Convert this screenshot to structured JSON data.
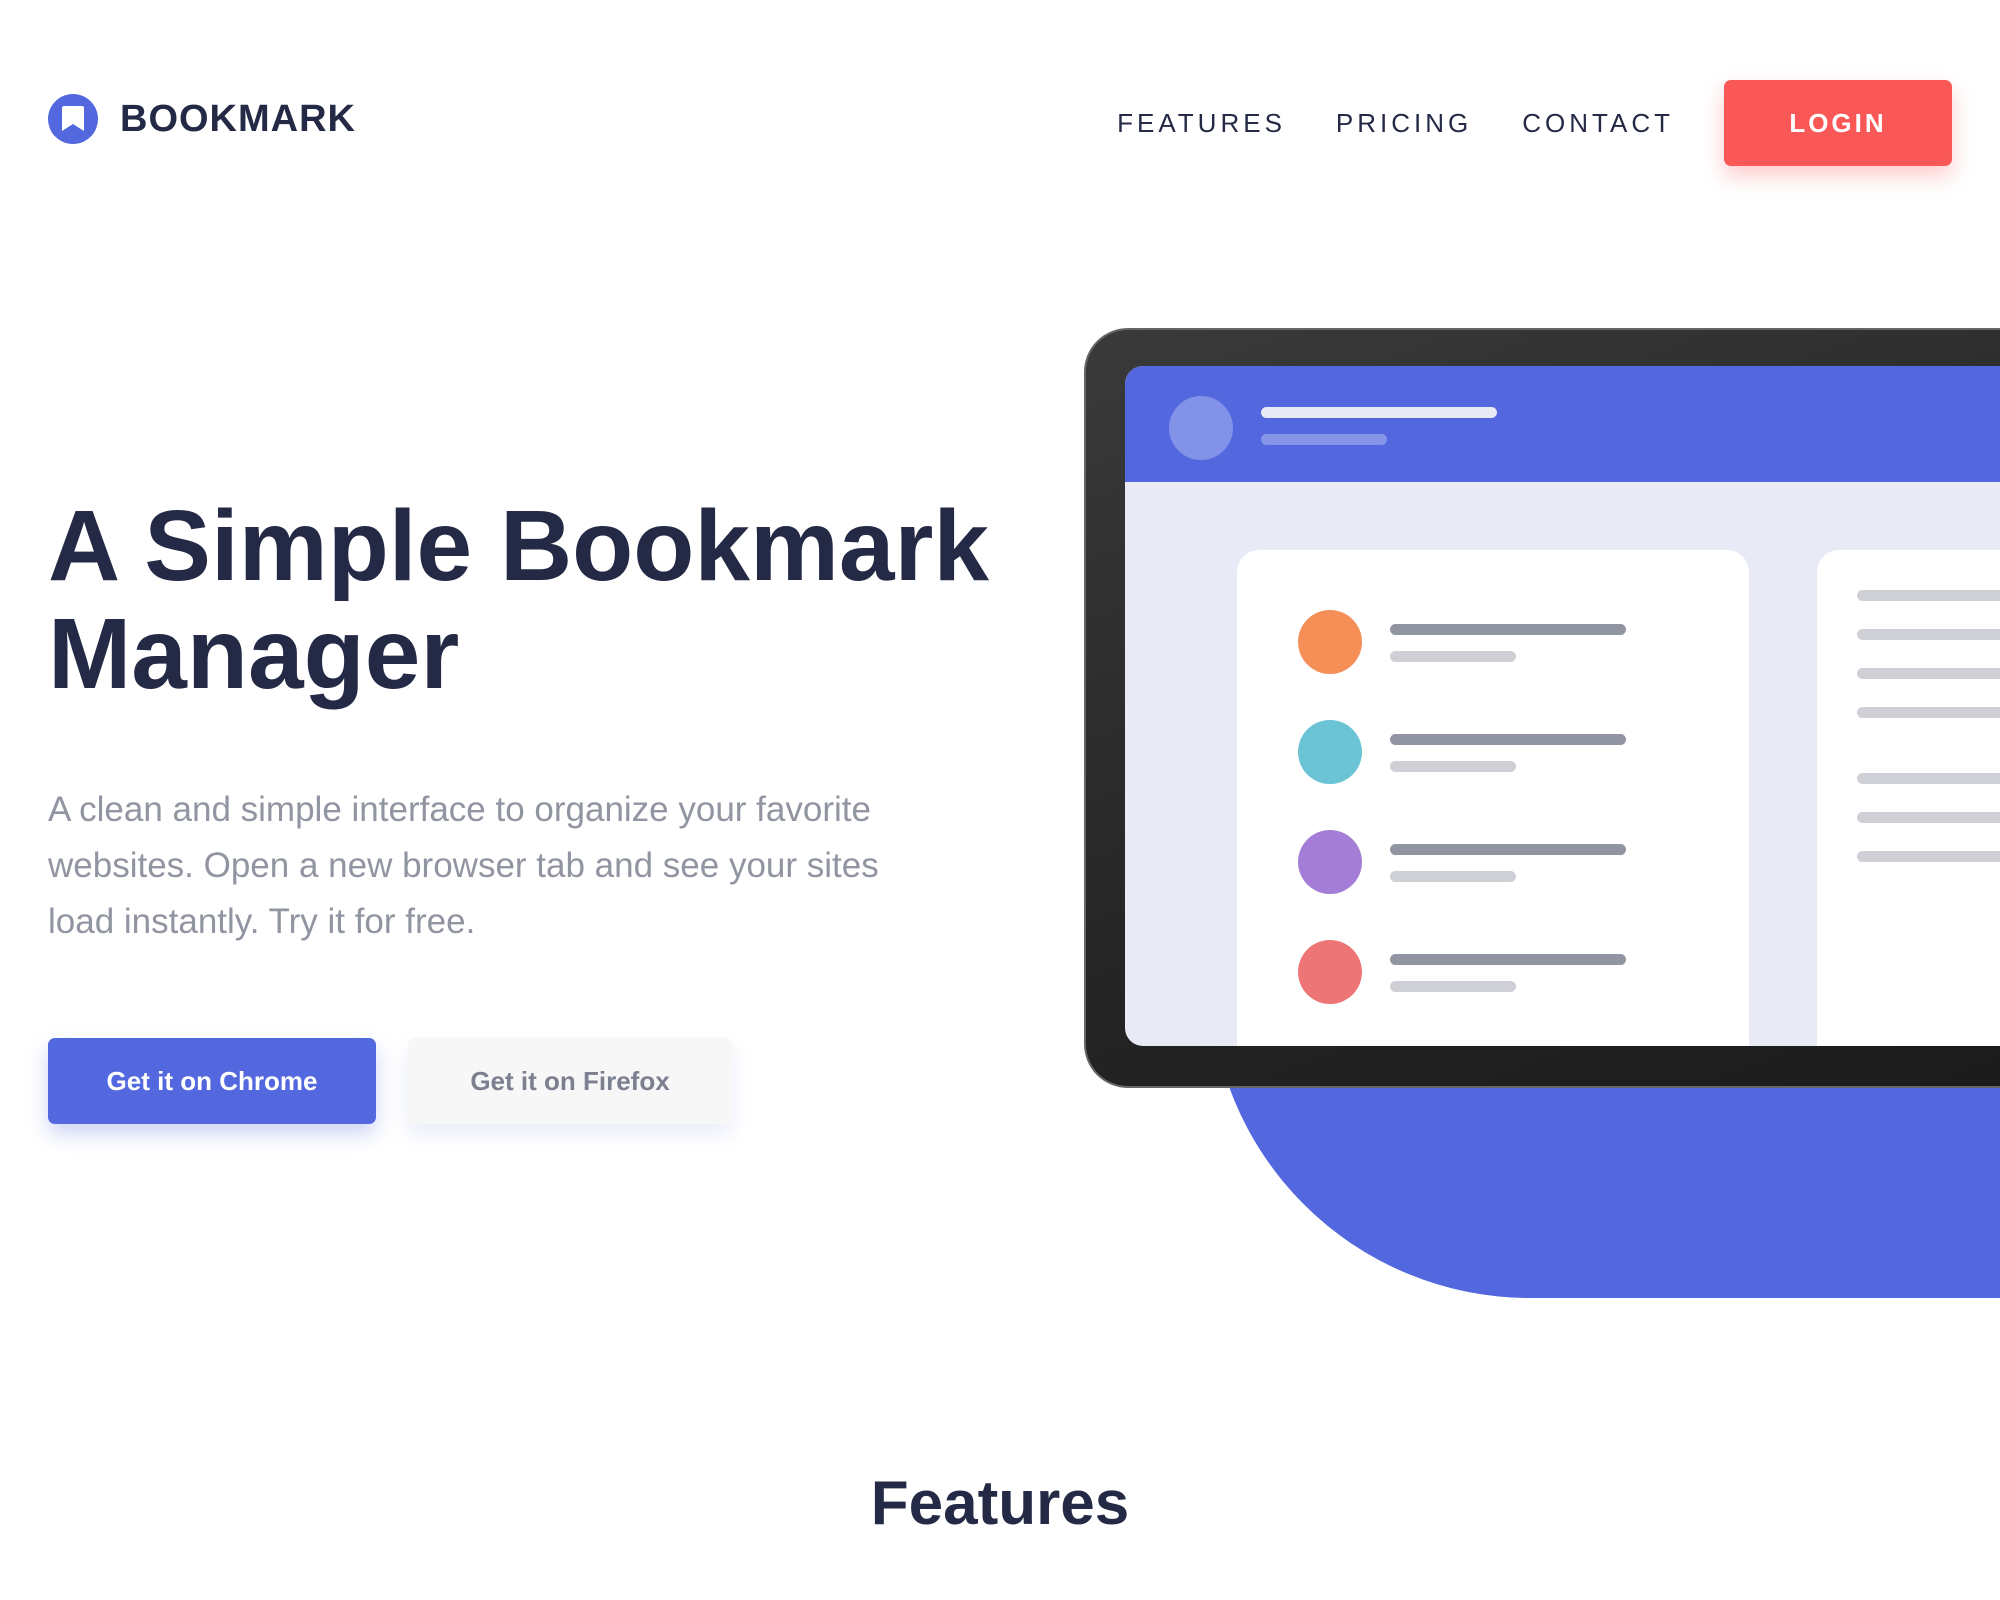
{
  "brand": {
    "name": "BOOKMARK",
    "logo_icon": "bookmark-icon",
    "accent": "#5368df",
    "secondary": "#fa5757",
    "dark": "#242a45",
    "grey": "#9194a1"
  },
  "nav": {
    "links": [
      "FEATURES",
      "PRICING",
      "CONTACT"
    ],
    "login_label": "LOGIN"
  },
  "hero": {
    "title_line1": "A Simple Bookmark",
    "title_line2": "Manager",
    "subtitle": "A clean and simple interface to organize your favorite websites. Open a new browser tab and see your sites load instantly. Try it for free.",
    "chrome_button": "Get it on Chrome",
    "firefox_button": "Get it on Firefox"
  },
  "illustration": {
    "list_dot_colors": [
      "#f68e57",
      "#6ac4d5",
      "#a47ed6",
      "#ed7575"
    ]
  },
  "features": {
    "heading": "Features"
  }
}
